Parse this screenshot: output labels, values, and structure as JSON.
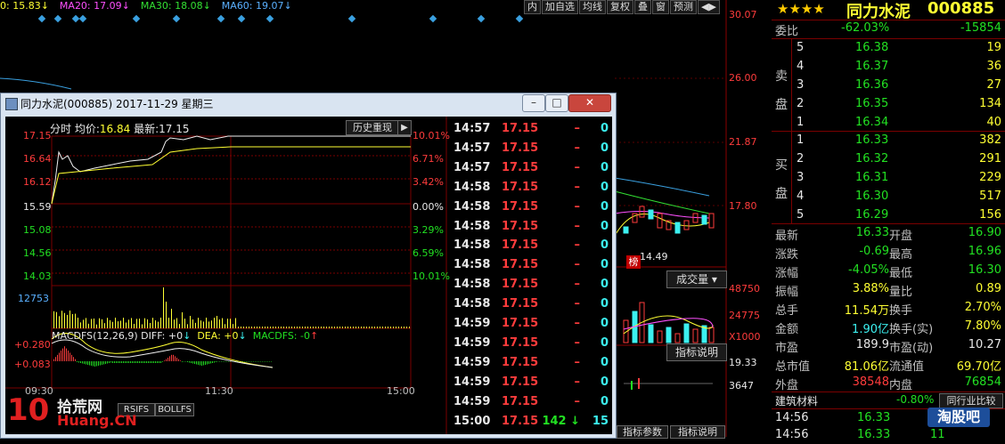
{
  "topbar": {
    "ma_items": [
      {
        "label": "0: 15.83",
        "color": "#ffff33"
      },
      {
        "label": "MA20: 17.09",
        "color": "#ff50ff"
      },
      {
        "label": "MA30: 18.08",
        "color": "#33e033"
      },
      {
        "label": "MA60: 19.07",
        "color": "#5ab0ff"
      }
    ],
    "tools": [
      "内",
      "加自选",
      "均线",
      "复权",
      "叠",
      "窗",
      "预测",
      "◀▶"
    ]
  },
  "kline": {
    "price_labels": [
      "30.07",
      "26.00",
      "21.87",
      "17.80"
    ],
    "vol_labels": [
      "48750",
      "24775",
      "X1000"
    ],
    "macd_labels": [
      "19.33",
      "3647"
    ],
    "low_label": "14.49",
    "volume_button": "成交量",
    "indicator_button": "指标说明",
    "bottom_tabs": [
      "指标参数",
      "指标说明"
    ],
    "badge": "榜"
  },
  "quote": {
    "stars": "★★★★",
    "name": "同力水泥",
    "code": "000885",
    "weibi_label": "委比",
    "weibi_value": "-62.03%",
    "weicha_value": "-15854",
    "sell_label": [
      "卖",
      "盘"
    ],
    "buy_label": [
      "买",
      "盘"
    ],
    "sell": [
      {
        "n": "5",
        "price": "16.38",
        "vol": "19"
      },
      {
        "n": "4",
        "price": "16.37",
        "vol": "36"
      },
      {
        "n": "3",
        "price": "16.36",
        "vol": "27"
      },
      {
        "n": "2",
        "price": "16.35",
        "vol": "134"
      },
      {
        "n": "1",
        "price": "16.34",
        "vol": "40"
      }
    ],
    "buy": [
      {
        "n": "1",
        "price": "16.33",
        "vol": "382"
      },
      {
        "n": "2",
        "price": "16.32",
        "vol": "291"
      },
      {
        "n": "3",
        "price": "16.31",
        "vol": "229"
      },
      {
        "n": "4",
        "price": "16.30",
        "vol": "517"
      },
      {
        "n": "5",
        "price": "16.29",
        "vol": "156"
      }
    ],
    "stats": [
      {
        "l1": "最新",
        "v1": "16.33",
        "c1": "#22e022",
        "l2": "开盘",
        "v2": "16.90",
        "c2": "#22e022"
      },
      {
        "l1": "涨跌",
        "v1": "-0.69",
        "c1": "#22e022",
        "l2": "最高",
        "v2": "16.96",
        "c2": "#22e022"
      },
      {
        "l1": "涨幅",
        "v1": "-4.05%",
        "c1": "#22e022",
        "l2": "最低",
        "v2": "16.30",
        "c2": "#22e022"
      },
      {
        "l1": "振幅",
        "v1": "3.88%",
        "c1": "#ffff33",
        "l2": "量比",
        "v2": "0.89",
        "c2": "#ffff33"
      },
      {
        "l1": "总手",
        "v1": "11.54万",
        "c1": "#ffff33",
        "l2": "换手",
        "v2": "2.70%",
        "c2": "#ffff33"
      },
      {
        "l1": "金额",
        "v1": "1.90亿",
        "c1": "#3cf0f0",
        "l2": "换手(实)",
        "v2": "7.80%",
        "c2": "#ffff33"
      },
      {
        "l1": "市盈",
        "v1": "189.9",
        "c1": "#e8e8e8",
        "l2": "市盈(动)",
        "v2": "10.27",
        "c2": "#e8e8e8"
      },
      {
        "l1": "总市值",
        "v1": "81.06亿",
        "c1": "#ffff33",
        "l2": "流通值",
        "v2": "69.70亿",
        "c2": "#ffff33"
      },
      {
        "l1": "外盘",
        "v1": "38548",
        "c1": "#ff3c3c",
        "l2": "内盘",
        "v2": "76854",
        "c2": "#22e022"
      }
    ],
    "industry_name": "建筑材料",
    "industry_pct": "-0.80%",
    "industry_btn": "同行业比较",
    "ticks": [
      {
        "t": "14:56",
        "p": "16.33",
        "v": "1"
      },
      {
        "t": "14:56",
        "p": "16.33",
        "v": "11"
      }
    ]
  },
  "popup": {
    "title": "同力水泥(000885) 2017-11-29 星期三",
    "header_label": "分时",
    "avg_label": "均价:",
    "avg_value": "16.84",
    "last_label": "最新:",
    "last_value": "17.15",
    "history_btn": "历史重现",
    "left_axis": [
      "17.15",
      "16.64",
      "16.12",
      "15.59",
      "15.08",
      "14.56",
      "14.03"
    ],
    "right_axis": [
      "10.01%",
      "6.71%",
      "3.42%",
      "0.00%",
      "3.29%",
      "6.59%",
      "10.01%"
    ],
    "vol_axis": "12753",
    "macd_title": "MACDFS(12,26,9)",
    "diff": "DIFF: +0",
    "dea": "DEA: +0",
    "macdfs": "MACDFS: -0",
    "macd_axis": [
      "+0.280",
      "+0.083"
    ],
    "time_axis": [
      "09:30",
      "11:30",
      "15:00"
    ],
    "bottom_tabs": [
      "RSIFS",
      "BOLLFS"
    ],
    "watermark_top": "拾荒网",
    "watermark_bottom": "Huang.CN",
    "watermark_num": "10",
    "ticks": [
      {
        "t": "14:57",
        "p": "17.15",
        "d": "–",
        "v": "0"
      },
      {
        "t": "14:57",
        "p": "17.15",
        "d": "–",
        "v": "0"
      },
      {
        "t": "14:57",
        "p": "17.15",
        "d": "–",
        "v": "0"
      },
      {
        "t": "14:58",
        "p": "17.15",
        "d": "–",
        "v": "0"
      },
      {
        "t": "14:58",
        "p": "17.15",
        "d": "–",
        "v": "0"
      },
      {
        "t": "14:58",
        "p": "17.15",
        "d": "–",
        "v": "0"
      },
      {
        "t": "14:58",
        "p": "17.15",
        "d": "–",
        "v": "0"
      },
      {
        "t": "14:58",
        "p": "17.15",
        "d": "–",
        "v": "0"
      },
      {
        "t": "14:58",
        "p": "17.15",
        "d": "–",
        "v": "0"
      },
      {
        "t": "14:58",
        "p": "17.15",
        "d": "–",
        "v": "0"
      },
      {
        "t": "14:59",
        "p": "17.15",
        "d": "–",
        "v": "0"
      },
      {
        "t": "14:59",
        "p": "17.15",
        "d": "–",
        "v": "0"
      },
      {
        "t": "14:59",
        "p": "17.15",
        "d": "–",
        "v": "0"
      },
      {
        "t": "14:59",
        "p": "17.15",
        "d": "–",
        "v": "0"
      },
      {
        "t": "14:59",
        "p": "17.15",
        "d": "–",
        "v": "0"
      },
      {
        "t": "15:00",
        "p": "17.15",
        "d": "142",
        "v": "15"
      }
    ]
  },
  "corner_logo": "淘股吧"
}
